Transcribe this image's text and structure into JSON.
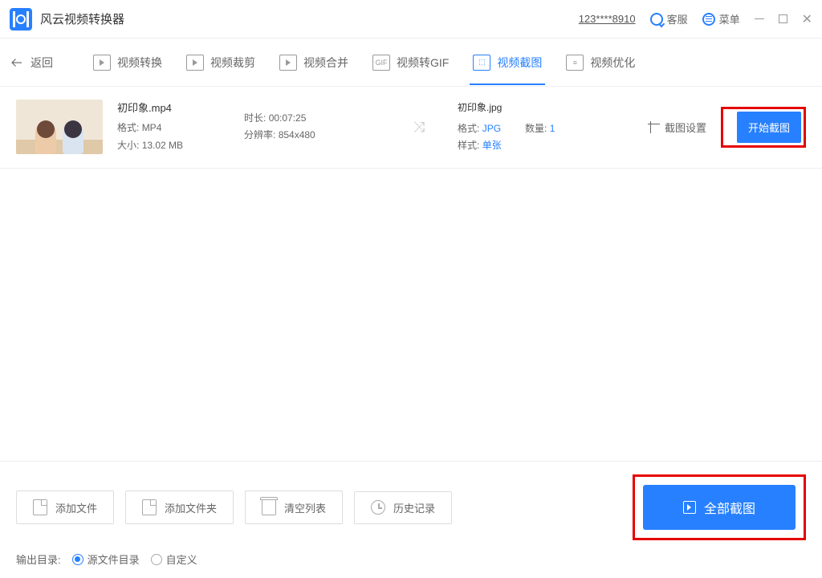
{
  "titlebar": {
    "app_name": "风云视频转换器",
    "masked_id": "123****8910",
    "support_label": "客服",
    "menu_label": "菜单"
  },
  "tabs": {
    "back": "返回",
    "convert": "视频转换",
    "crop": "视频裁剪",
    "merge": "视频合并",
    "to_gif": "视频转GIF",
    "screenshot": "视频截图",
    "optimize": "视频优化"
  },
  "row": {
    "filename": "初印象.mp4",
    "format_label": "格式:",
    "format_value": "MP4",
    "size_label": "大小:",
    "size_value": "13.02 MB",
    "duration_label": "时长:",
    "duration_value": "00:07:25",
    "resolution_label": "分辨率:",
    "resolution_value": "854x480",
    "out_filename": "初印象.jpg",
    "out_format_label": "格式:",
    "out_format_value": "JPG",
    "count_label": "数量:",
    "count_value": "1",
    "style_label": "样式:",
    "style_value": "单张",
    "settings_label": "截图设置",
    "start_label": "开始截图"
  },
  "bottom": {
    "add_file": "添加文件",
    "add_folder": "添加文件夹",
    "clear": "清空列表",
    "history": "历史记录",
    "all_label": "全部截图",
    "output_label": "输出目录:",
    "src_dir": "源文件目录",
    "custom": "自定义"
  }
}
